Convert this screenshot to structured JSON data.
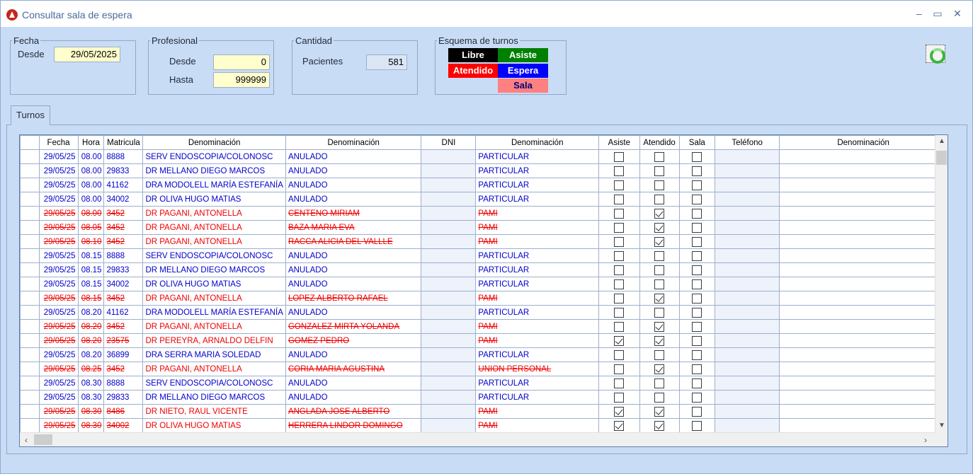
{
  "window": {
    "title": "Consultar sala de espera",
    "min": "–",
    "max": "▭",
    "close": "✕"
  },
  "fecha": {
    "legend": "Fecha",
    "desde_label": "Desde",
    "desde_value": "29/05/2025"
  },
  "profesional": {
    "legend": "Profesional",
    "desde_label": "Desde",
    "desde_value": "0",
    "hasta_label": "Hasta",
    "hasta_value": "999999"
  },
  "cantidad": {
    "legend": "Cantidad",
    "pacientes_label": "Pacientes",
    "pacientes_value": "581"
  },
  "esquema": {
    "legend": "Esquema de turnos",
    "libre": "Libre",
    "asiste": "Asiste",
    "atendido": "Atendido",
    "espera": "Espera",
    "sala": "Sala",
    "colors": {
      "libre": "#000000",
      "asiste": "#008000",
      "atendido": "#ff0000",
      "espera": "#0000ff",
      "sala": "#ff8080"
    }
  },
  "tabs": {
    "turnos": "Turnos"
  },
  "grid": {
    "headers": [
      "Fecha",
      "Hora",
      "Matricula",
      "Denominación",
      "Denominación",
      "DNI",
      "Denominación",
      "Asiste",
      "Atendido",
      "Sala",
      "Teléfono",
      "Denominación"
    ],
    "rows": [
      {
        "st": "blue",
        "fecha": "29/05/25",
        "hora": "08.00",
        "mat": "8888",
        "prof": "SERV ENDOSCOPIA/COLONOSC",
        "pac": "ANULADO",
        "os": "PARTICULAR",
        "asiste": false,
        "atendido": false,
        "sala": false
      },
      {
        "st": "blue",
        "fecha": "29/05/25",
        "hora": "08.00",
        "mat": "29833",
        "prof": "DR MELLANO DIEGO MARCOS",
        "pac": "ANULADO",
        "os": "PARTICULAR",
        "asiste": false,
        "atendido": false,
        "sala": false
      },
      {
        "st": "blue",
        "fecha": "29/05/25",
        "hora": "08.00",
        "mat": "41162",
        "prof": "DRA MODOLELL MARÍA ESTEFANÍA",
        "pac": "ANULADO",
        "os": "PARTICULAR",
        "asiste": false,
        "atendido": false,
        "sala": false
      },
      {
        "st": "blue",
        "fecha": "29/05/25",
        "hora": "08.00",
        "mat": "34002",
        "prof": "DR OLIVA HUGO MATIAS",
        "pac": "ANULADO",
        "os": "PARTICULAR",
        "asiste": false,
        "atendido": false,
        "sala": false
      },
      {
        "st": "red",
        "fecha": "29/05/25",
        "hora": "08.00",
        "mat": "3452",
        "prof": "DR PAGANI, ANTONELLA",
        "pac": "CENTENO MIRIAM",
        "os": "PAMI",
        "asiste": false,
        "atendido": true,
        "sala": false
      },
      {
        "st": "red",
        "fecha": "29/05/25",
        "hora": "08.05",
        "mat": "3452",
        "prof": "DR PAGANI, ANTONELLA",
        "pac": "BAZA MARIA EVA",
        "os": "PAMI",
        "asiste": false,
        "atendido": true,
        "sala": false
      },
      {
        "st": "red",
        "fecha": "29/05/25",
        "hora": "08.10",
        "mat": "3452",
        "prof": "DR PAGANI, ANTONELLA",
        "pac": "RACCA ALICIA DEL VALLLE",
        "os": "PAMI",
        "asiste": false,
        "atendido": true,
        "sala": false
      },
      {
        "st": "blue",
        "fecha": "29/05/25",
        "hora": "08.15",
        "mat": "8888",
        "prof": "SERV ENDOSCOPIA/COLONOSC",
        "pac": "ANULADO",
        "os": "PARTICULAR",
        "asiste": false,
        "atendido": false,
        "sala": false
      },
      {
        "st": "blue",
        "fecha": "29/05/25",
        "hora": "08.15",
        "mat": "29833",
        "prof": "DR MELLANO DIEGO MARCOS",
        "pac": "ANULADO",
        "os": "PARTICULAR",
        "asiste": false,
        "atendido": false,
        "sala": false
      },
      {
        "st": "blue",
        "fecha": "29/05/25",
        "hora": "08.15",
        "mat": "34002",
        "prof": "DR OLIVA HUGO MATIAS",
        "pac": "ANULADO",
        "os": "PARTICULAR",
        "asiste": false,
        "atendido": false,
        "sala": false
      },
      {
        "st": "red",
        "fecha": "29/05/25",
        "hora": "08.15",
        "mat": "3452",
        "prof": "DR PAGANI, ANTONELLA",
        "pac": "LOPEZ ALBERTO RAFAEL",
        "os": "PAMI",
        "asiste": false,
        "atendido": true,
        "sala": false
      },
      {
        "st": "blue",
        "fecha": "29/05/25",
        "hora": "08.20",
        "mat": "41162",
        "prof": "DRA MODOLELL MARÍA ESTEFANÍA",
        "pac": "ANULADO",
        "os": "PARTICULAR",
        "asiste": false,
        "atendido": false,
        "sala": false
      },
      {
        "st": "red",
        "fecha": "29/05/25",
        "hora": "08.20",
        "mat": "3452",
        "prof": "DR PAGANI, ANTONELLA",
        "pac": "GONZALEZ MIRTA YOLANDA",
        "os": "PAMI",
        "asiste": false,
        "atendido": true,
        "sala": false
      },
      {
        "st": "red",
        "fecha": "29/05/25",
        "hora": "08.20",
        "mat": "23575",
        "prof": "DR PEREYRA, ARNALDO DELFIN",
        "pac": "GOMEZ PEDRO",
        "os": "PAMI",
        "asiste": true,
        "atendido": true,
        "sala": false
      },
      {
        "st": "blue",
        "fecha": "29/05/25",
        "hora": "08.20",
        "mat": "36899",
        "prof": "DRA SERRA MARIA SOLEDAD",
        "pac": "ANULADO",
        "os": "PARTICULAR",
        "asiste": false,
        "atendido": false,
        "sala": false
      },
      {
        "st": "red",
        "fecha": "29/05/25",
        "hora": "08.25",
        "mat": "3452",
        "prof": "DR PAGANI, ANTONELLA",
        "pac": "CORIA MARIA AGUSTINA",
        "os": "UNION PERSONAL",
        "asiste": false,
        "atendido": true,
        "sala": false
      },
      {
        "st": "blue",
        "fecha": "29/05/25",
        "hora": "08.30",
        "mat": "8888",
        "prof": "SERV ENDOSCOPIA/COLONOSC",
        "pac": "ANULADO",
        "os": "PARTICULAR",
        "asiste": false,
        "atendido": false,
        "sala": false
      },
      {
        "st": "blue",
        "fecha": "29/05/25",
        "hora": "08.30",
        "mat": "29833",
        "prof": "DR MELLANO DIEGO MARCOS",
        "pac": "ANULADO",
        "os": "PARTICULAR",
        "asiste": false,
        "atendido": false,
        "sala": false
      },
      {
        "st": "red",
        "fecha": "29/05/25",
        "hora": "08.30",
        "mat": "8486",
        "prof": "DR NIETO, RAUL VICENTE",
        "pac": "ANGLADA JOSE ALBERTO",
        "os": "PAMI",
        "asiste": true,
        "atendido": true,
        "sala": false
      },
      {
        "st": "red",
        "fecha": "29/05/25",
        "hora": "08.30",
        "mat": "34002",
        "prof": "DR OLIVA HUGO MATIAS",
        "pac": "HERRERA LINDOR DOMINGO",
        "os": "PAMI",
        "asiste": true,
        "atendido": true,
        "sala": false
      }
    ]
  }
}
